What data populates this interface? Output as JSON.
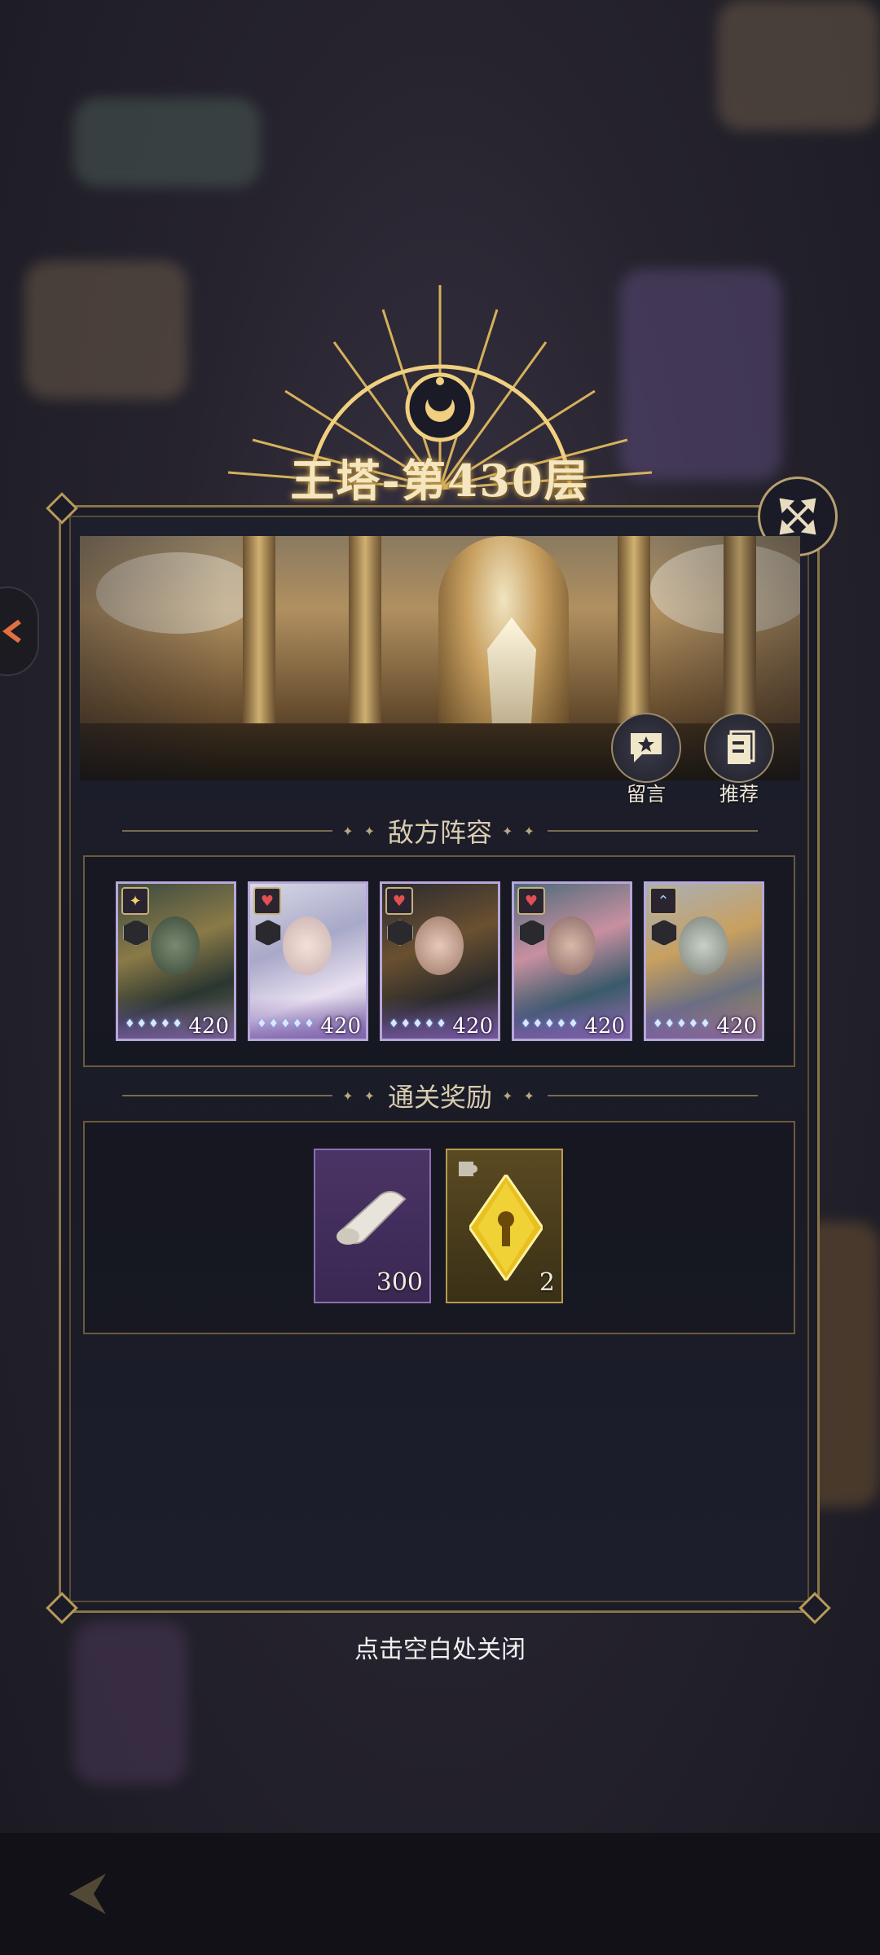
{
  "header": {
    "title": "王塔-第430层"
  },
  "banner": {
    "buttons": [
      {
        "label": "留言",
        "icon": "message-star-icon"
      },
      {
        "label": "推荐",
        "icon": "recommend-card-icon"
      }
    ]
  },
  "enemy_section": {
    "title": "敌方阵容",
    "heroes": [
      {
        "level": "420",
        "faction": "lightning",
        "class": "shield",
        "frame_color": "#b7a7d9"
      },
      {
        "level": "420",
        "faction": "heart",
        "class": "sword",
        "frame_color": "#b7a7d9"
      },
      {
        "level": "420",
        "faction": "heart",
        "class": "bow",
        "frame_color": "#b7a7d9"
      },
      {
        "level": "420",
        "faction": "heart",
        "class": "star",
        "frame_color": "#b7a7d9"
      },
      {
        "level": "420",
        "faction": "wing",
        "class": "bow",
        "frame_color": "#b7a7d9"
      }
    ]
  },
  "reward_section": {
    "title": "通关奖励",
    "items": [
      {
        "name": "scroll",
        "count": "300",
        "frame_color": "#5a3e78"
      },
      {
        "name": "gold-crystal",
        "count": "2",
        "frame_color": "#7a6630"
      }
    ]
  },
  "close_hint": "点击空白处关闭",
  "colors": {
    "accent_gold": "#b89a5a",
    "panel_bg": "#1b1c28",
    "hero_frame": "#b7a7d9"
  }
}
